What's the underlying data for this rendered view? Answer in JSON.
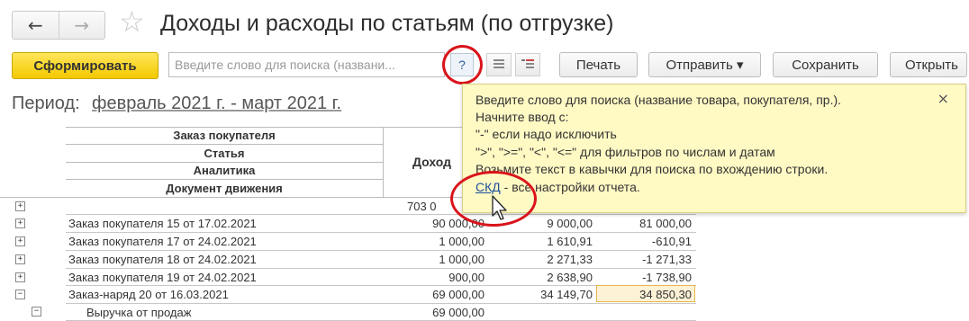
{
  "title": "Доходы и расходы по статьям (по отгрузке)",
  "nav": {
    "back_icon": "←",
    "forward_icon": "→",
    "favorite_icon": "☆"
  },
  "toolbar": {
    "generate": "Сформировать",
    "search_placeholder": "Введите слово для поиска (названи...",
    "help": "?",
    "print": "Печать",
    "send": "Отправить ▾",
    "save": "Сохранить",
    "open": "Открыть"
  },
  "period": {
    "label": "Период:",
    "value": "февраль 2021 г. - март 2021 г."
  },
  "table": {
    "headers": [
      "Заказ покупателя",
      "Статья",
      "Аналитика",
      "Документ движения"
    ],
    "income_header": "Доход",
    "total": {
      "income": "703 0"
    },
    "rows": [
      {
        "name": "Заказ покупателя 15 от 17.02.2021",
        "income": "90 000,00",
        "expense": "9 000,00",
        "result": "81 000,00"
      },
      {
        "name": "Заказ покупателя 17 от 24.02.2021",
        "income": "1 000,00",
        "expense": "1 610,91",
        "result": "-610,91"
      },
      {
        "name": "Заказ покупателя 18 от 24.02.2021",
        "income": "1 000,00",
        "expense": "2 271,33",
        "result": "-1 271,33"
      },
      {
        "name": "Заказ покупателя 19 от 24.02.2021",
        "income": "900,00",
        "expense": "2 638,90",
        "result": "-1 738,90"
      },
      {
        "name": "Заказ-наряд 20 от 16.03.2021",
        "income": "69 000,00",
        "expense": "34 149,70",
        "result": "34 850,30"
      },
      {
        "name": "Выручка от продаж",
        "income": "69 000,00",
        "expense": "",
        "result": ""
      }
    ]
  },
  "popup": {
    "line1": "Введите слово для поиска (название товара, покупателя, пр.).",
    "line2": "Начните ввод с:",
    "line3": "\"-\" если надо исключить",
    "line4": "\">\", \">=\", \"<\", \"<=\" для фильтров по числам и датам",
    "line5": "Возьмите текст в кавычки для поиска по вхождению строки.",
    "link": "СКД",
    "line6_rest": " - все настройки отчета.",
    "close": "×"
  },
  "colors": {
    "accent_yellow": "#f3c900",
    "popup_bg": "#fff9c4",
    "highlight_red": "#d9141b",
    "link": "#1f4e9c"
  }
}
